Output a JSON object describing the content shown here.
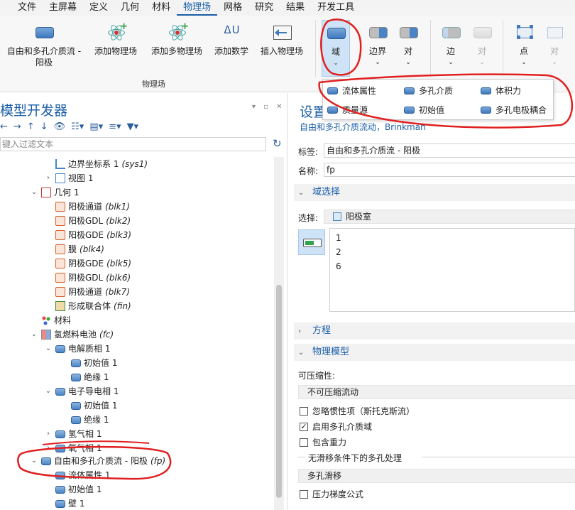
{
  "menubar": {
    "tabs": [
      "文件",
      "主屏幕",
      "定义",
      "几何",
      "材料",
      "物理场",
      "网格",
      "研究",
      "结果",
      "开发工具"
    ],
    "active_index": 5
  },
  "ribbon": {
    "buttons": {
      "free_porous": "自由和多孔介质流 -",
      "free_porous_2": "阳极",
      "add_physics_1": "添加物理场",
      "add_physics_2": "添加多物理场",
      "add_math": "添加数学",
      "insert_physics": "插入物理场",
      "domain": "域",
      "boundary": "边界",
      "pair": "对",
      "edge": "边",
      "edge_pair": "对",
      "point": "点",
      "point_pair": "对"
    },
    "group_label": "物理场"
  },
  "domain_menu": {
    "items": [
      "流体属性",
      "多孔介质",
      "体积力",
      "质量源",
      "初始值",
      "多孔电极耦合"
    ]
  },
  "model_builder": {
    "title": "模型开发器",
    "filter_placeholder": "键入过滤文本",
    "tree": [
      {
        "label": "边界坐标系 1",
        "tag": "(sys1)"
      },
      {
        "label": "视图 1",
        "tag": ""
      },
      {
        "label": "几何 1",
        "tag": ""
      },
      {
        "label": "阳极通道",
        "tag": "(blk1)"
      },
      {
        "label": "阳极GDL",
        "tag": "(blk2)"
      },
      {
        "label": "阳极GDE",
        "tag": "(blk3)"
      },
      {
        "label": "膜",
        "tag": "(blk4)"
      },
      {
        "label": "阴极GDE",
        "tag": "(blk5)"
      },
      {
        "label": "阴极GDL",
        "tag": "(blk6)"
      },
      {
        "label": "阴极通道",
        "tag": "(blk7)"
      },
      {
        "label": "形成联合体",
        "tag": "(fin)"
      },
      {
        "label": "材料",
        "tag": ""
      },
      {
        "label": "氢燃料电池",
        "tag": "(fc)"
      },
      {
        "label": "电解质相 1",
        "tag": ""
      },
      {
        "label": "初始值 1",
        "tag": ""
      },
      {
        "label": "绝缘 1",
        "tag": ""
      },
      {
        "label": "电子导电相 1",
        "tag": ""
      },
      {
        "label": "初始值 1",
        "tag": ""
      },
      {
        "label": "绝缘 1",
        "tag": ""
      },
      {
        "label": "氢气相 1",
        "tag": ""
      },
      {
        "label": "氧气相 1",
        "tag": ""
      },
      {
        "label": "自由和多孔介质流 - 阳极",
        "tag": "(fp)"
      },
      {
        "label": "流体属性 1",
        "tag": ""
      },
      {
        "label": "初始值 1",
        "tag": ""
      },
      {
        "label": "壁 1",
        "tag": ""
      }
    ]
  },
  "settings": {
    "title": "设置",
    "subtitle": "自由和多孔介质流动，Brinkman",
    "label_caption": "标签:",
    "label_value": "自由和多孔介质流 - 阳极",
    "name_caption": "名称:",
    "name_value": "fp",
    "section_domain": "域选择",
    "selection_caption": "选择:",
    "selection_value": "阳极室",
    "selection_items": [
      "1",
      "2",
      "6"
    ],
    "section_equation": "方程",
    "section_physics_model": "物理模型",
    "compressibility_caption": "可压缩性:",
    "compressibility_value": "不可压缩流动",
    "cb_neglect_inertia": "忽略惯性项（斯托克斯流）",
    "cb_enable_porous": "启用多孔介质域",
    "cb_gravity": "包含重力",
    "noslip_caption": "无滑移条件下的多孔处理",
    "noslip_value": "多孔滑移",
    "cb_pressure_gradient": "压力梯度公式"
  },
  "colors": {
    "accent": "#1a5ea8",
    "annotation": "#e02020",
    "selected_bg": "#cfe3f7"
  }
}
